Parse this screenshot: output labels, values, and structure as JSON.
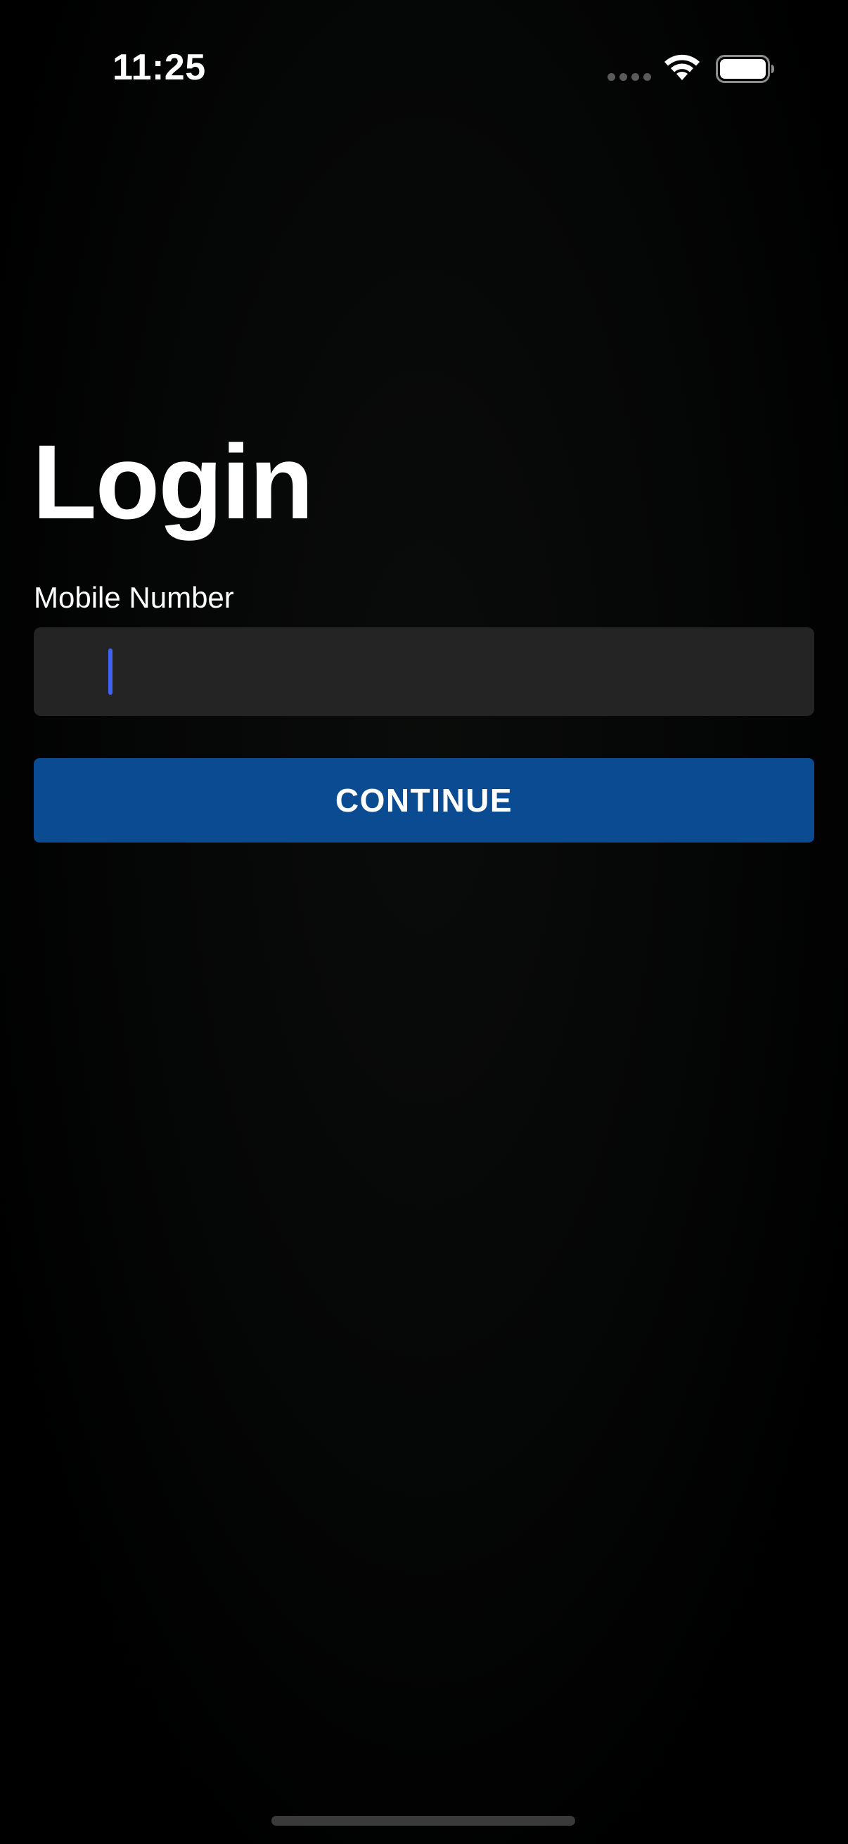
{
  "status_bar": {
    "time": "11:25",
    "icons": [
      "signal-dots-icon",
      "wifi-icon",
      "battery-icon"
    ]
  },
  "login": {
    "title": "Login",
    "mobile_label": "Mobile Number",
    "mobile_value": "",
    "continue_label": "CONTINUE"
  },
  "colors": {
    "background": "#000000",
    "field_background": "#242424",
    "button_background": "#0a4b91",
    "cursor": "#3f63f0",
    "text": "#ffffff"
  }
}
